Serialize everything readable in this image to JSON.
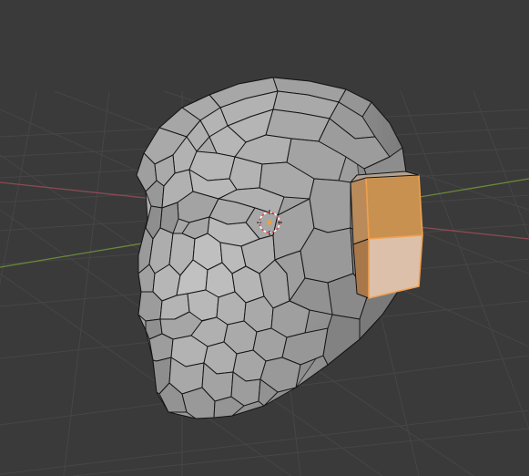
{
  "viewport": {
    "mode": "edit-mode",
    "object": "head-mesh",
    "selection": "ear-extrusion-faces",
    "shading": "solid",
    "background_color": "#3a3a3a",
    "grid_color": "#4a4a4a",
    "x_axis_color": "#8a4a55",
    "y_axis_color": "#6a8a3a",
    "mesh_fill": "#9a9a9a",
    "mesh_edge": "#141414",
    "selected_face_color": "#d19a60",
    "selected_edge_color": "#f0a050",
    "cursor_icon": "3d-cursor-icon"
  }
}
